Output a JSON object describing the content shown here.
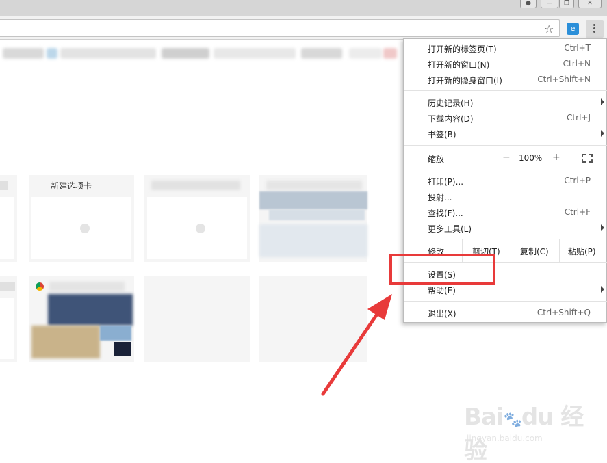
{
  "toolbar": {
    "star_icon": "star-outline-icon",
    "extension_icon": "extension-icon",
    "menu_icon": "vertical-dots-icon"
  },
  "tiles": {
    "newtab_title": "新建选项卡"
  },
  "menu": {
    "new_tab": {
      "label": "打开新的标签页(T)",
      "shortcut": "Ctrl+T"
    },
    "new_window": {
      "label": "打开新的窗口(N)",
      "shortcut": "Ctrl+N"
    },
    "incognito": {
      "label": "打开新的隐身窗口(I)",
      "shortcut": "Ctrl+Shift+N"
    },
    "history": {
      "label": "历史记录(H)"
    },
    "downloads": {
      "label": "下载内容(D)",
      "shortcut": "Ctrl+J"
    },
    "bookmarks": {
      "label": "书签(B)"
    },
    "zoom": {
      "label": "缩放",
      "minus": "−",
      "value": "100%",
      "plus": "+"
    },
    "print": {
      "label": "打印(P)...",
      "shortcut": "Ctrl+P"
    },
    "cast": {
      "label": "投射..."
    },
    "find": {
      "label": "查找(F)...",
      "shortcut": "Ctrl+F"
    },
    "more_tools": {
      "label": "更多工具(L)"
    },
    "edit": {
      "label": "修改",
      "cut": "剪切(T)",
      "copy": "复制(C)",
      "paste": "粘贴(P)"
    },
    "settings": {
      "label": "设置(S)"
    },
    "help": {
      "label": "帮助(E)"
    },
    "exit": {
      "label": "退出(X)",
      "shortcut": "Ctrl+Shift+Q"
    }
  },
  "annotation": {
    "highlight_color": "#e83a3a",
    "watermark_brand": "Bai du 经验",
    "watermark_url": "jingyan.baidu.com"
  }
}
